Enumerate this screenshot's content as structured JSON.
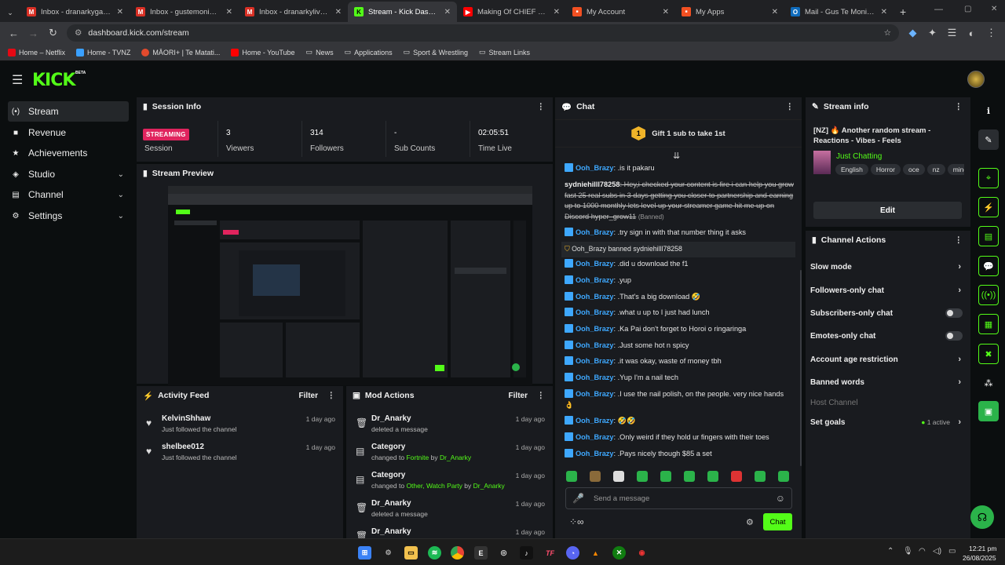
{
  "browser": {
    "tabs": [
      {
        "label": "Inbox - dranarkygaming@",
        "fav": "M",
        "color": "#d93025"
      },
      {
        "label": "Inbox - gustemoni@gma",
        "fav": "M",
        "color": "#d93025"
      },
      {
        "label": "Inbox - dranarkylive@gm",
        "fav": "M",
        "color": "#d93025"
      },
      {
        "label": "Stream - Kick Dashboard",
        "fav": "K",
        "color": "#53fc18"
      },
      {
        "label": "Making Of CHIEF OF WAR",
        "fav": "▶",
        "color": "#ff0000"
      },
      {
        "label": "My Account",
        "fav": "■",
        "color": "#f25022"
      },
      {
        "label": "My Apps",
        "fav": "■",
        "color": "#f25022"
      },
      {
        "label": "Mail - Gus Te Moni - Outl",
        "fav": "O",
        "color": "#0f6cbd"
      }
    ],
    "url": "dashboard.kick.com/stream",
    "bookmarks": [
      {
        "label": "Home – Netflix",
        "color": "#e50914"
      },
      {
        "label": "Home - TVNZ",
        "color": "#3aa0ff"
      },
      {
        "label": "MĀORI+ | Te Matati...",
        "color": "#e24a2d"
      },
      {
        "label": "Home - YouTube",
        "color": "#ff0000"
      },
      {
        "label": "News",
        "color": "#999"
      },
      {
        "label": "Applications",
        "color": "#999"
      },
      {
        "label": "Sport & Wrestling",
        "color": "#999"
      },
      {
        "label": "Stream Links",
        "color": "#999"
      }
    ]
  },
  "app": {
    "logo": "KICK",
    "beta": "BETA",
    "nav": [
      {
        "label": "Stream",
        "icon": "(•)"
      },
      {
        "label": "Revenue",
        "icon": "■"
      },
      {
        "label": "Achievements",
        "icon": "★"
      },
      {
        "label": "Studio",
        "icon": "◈"
      },
      {
        "label": "Channel",
        "icon": "▤"
      },
      {
        "label": "Settings",
        "icon": "⚙"
      }
    ]
  },
  "session": {
    "title": "Session Info",
    "badge": "STREAMING",
    "badge_label": "Session",
    "stats": [
      {
        "value": "3",
        "label": "Viewers"
      },
      {
        "value": "314",
        "label": "Followers"
      },
      {
        "value": "-",
        "label": "Sub Counts"
      },
      {
        "value": "02:05:51",
        "label": "Time Live"
      }
    ]
  },
  "preview": {
    "title": "Stream Preview"
  },
  "activity": {
    "title": "Activity Feed",
    "filter": "Filter",
    "items": [
      {
        "name": "KelvinShhaw",
        "sub": "Just followed the channel",
        "time": "1 day ago"
      },
      {
        "name": "shelbee012",
        "sub": "Just followed the channel",
        "time": "1 day ago"
      }
    ]
  },
  "mod": {
    "title": "Mod Actions",
    "filter": "Filter",
    "items": [
      {
        "name": "Dr_Anarky",
        "pre": "deleted a message",
        "hl": "",
        "mid": "",
        "by": "",
        "time": "1 day ago"
      },
      {
        "name": "Category",
        "pre": "changed to ",
        "hl": "Fortnite",
        "mid": " by ",
        "by": "Dr_Anarky",
        "time": "1 day ago"
      },
      {
        "name": "Category",
        "pre": "changed to ",
        "hl": "Other, Watch Party",
        "mid": " by ",
        "by": "Dr_Anarky",
        "time": "1 day ago"
      },
      {
        "name": "Dr_Anarky",
        "pre": "deleted a message",
        "hl": "",
        "mid": "",
        "by": "",
        "time": "1 day ago"
      },
      {
        "name": "Dr_Anarky",
        "pre": "",
        "hl": "",
        "mid": "",
        "by": "",
        "time": "1 day ago"
      }
    ]
  },
  "chat": {
    "title": "Chat",
    "gift": "Gift 1 sub to take 1st",
    "gift_count": "1",
    "messages": [
      {
        "user": "Ooh_Brazy",
        "text": ": .is it pakaru"
      },
      {
        "user": "sydniehilll78258",
        "text": ": Hey,i checked your content is fire i can help you grow fast 25 real subs in 3 days getting you closer to partnership and earning up to 1000 monthly lets level up your streamer game hit me up on Discord hyper_grow11",
        "tag": "(Banned)"
      },
      {
        "user": "Ooh_Brazy",
        "text": ": .try sign in with that number thing it asks"
      },
      {
        "user": "Ooh_Brazy",
        "text": " banned sydniehilll78258"
      },
      {
        "user": "Ooh_Brazy",
        "text": ": .did u download the f1"
      },
      {
        "user": "Ooh_Brazy",
        "text": ": .yup"
      },
      {
        "user": "Ooh_Brazy",
        "text": ": .That's a big download 🤣"
      },
      {
        "user": "Ooh_Brazy",
        "text": ": .what u up to I just had lunch"
      },
      {
        "user": "Ooh_Brazy",
        "text": ": .Ka Pai don't forget to Horoi o ringaringa"
      },
      {
        "user": "Ooh_Brazy",
        "text": ": .Just some hot n spicy"
      },
      {
        "user": "Ooh_Brazy",
        "text": ": .it was okay, waste of money tbh"
      },
      {
        "user": "Ooh_Brazy",
        "text": ": .Yup I'm a nail tech"
      },
      {
        "user": "Ooh_Brazy",
        "text": ": .I use the nail polish, on the people. very nice hands 👌"
      },
      {
        "user": "Ooh_Brazy",
        "text": ": 🤣🤣"
      },
      {
        "user": "Ooh_Brazy",
        "text": ": .Only weird if they hold ur fingers with their toes"
      },
      {
        "user": "Ooh_Brazy",
        "text": ": .Pays nicely though $85 a set"
      }
    ],
    "placeholder": "Send a message",
    "send": "Chat"
  },
  "streaminfo": {
    "title": "Stream info",
    "stream_title": "[NZ] 🔥 Another random stream - Reactions - Vibes - Feels",
    "category": "Just Chatting",
    "tags": [
      "English",
      "Horror",
      "oce",
      "nz",
      "mine"
    ],
    "edit": "Edit"
  },
  "actions": {
    "title": "Channel Actions",
    "items": [
      {
        "label": "Slow mode",
        "kind": "chevron"
      },
      {
        "label": "Followers-only chat",
        "kind": "chevron"
      },
      {
        "label": "Subscribers-only chat",
        "kind": "toggle"
      },
      {
        "label": "Emotes-only chat",
        "kind": "toggle"
      },
      {
        "label": "Account age restriction",
        "kind": "chevron"
      },
      {
        "label": "Banned words",
        "kind": "chevron"
      },
      {
        "label": "Host Channel",
        "kind": "none"
      },
      {
        "label": "Set goals",
        "kind": "chevron",
        "extra": "1 active"
      }
    ]
  },
  "taskbar": {
    "time": "12:21 pm",
    "date": "26/08/2025"
  }
}
